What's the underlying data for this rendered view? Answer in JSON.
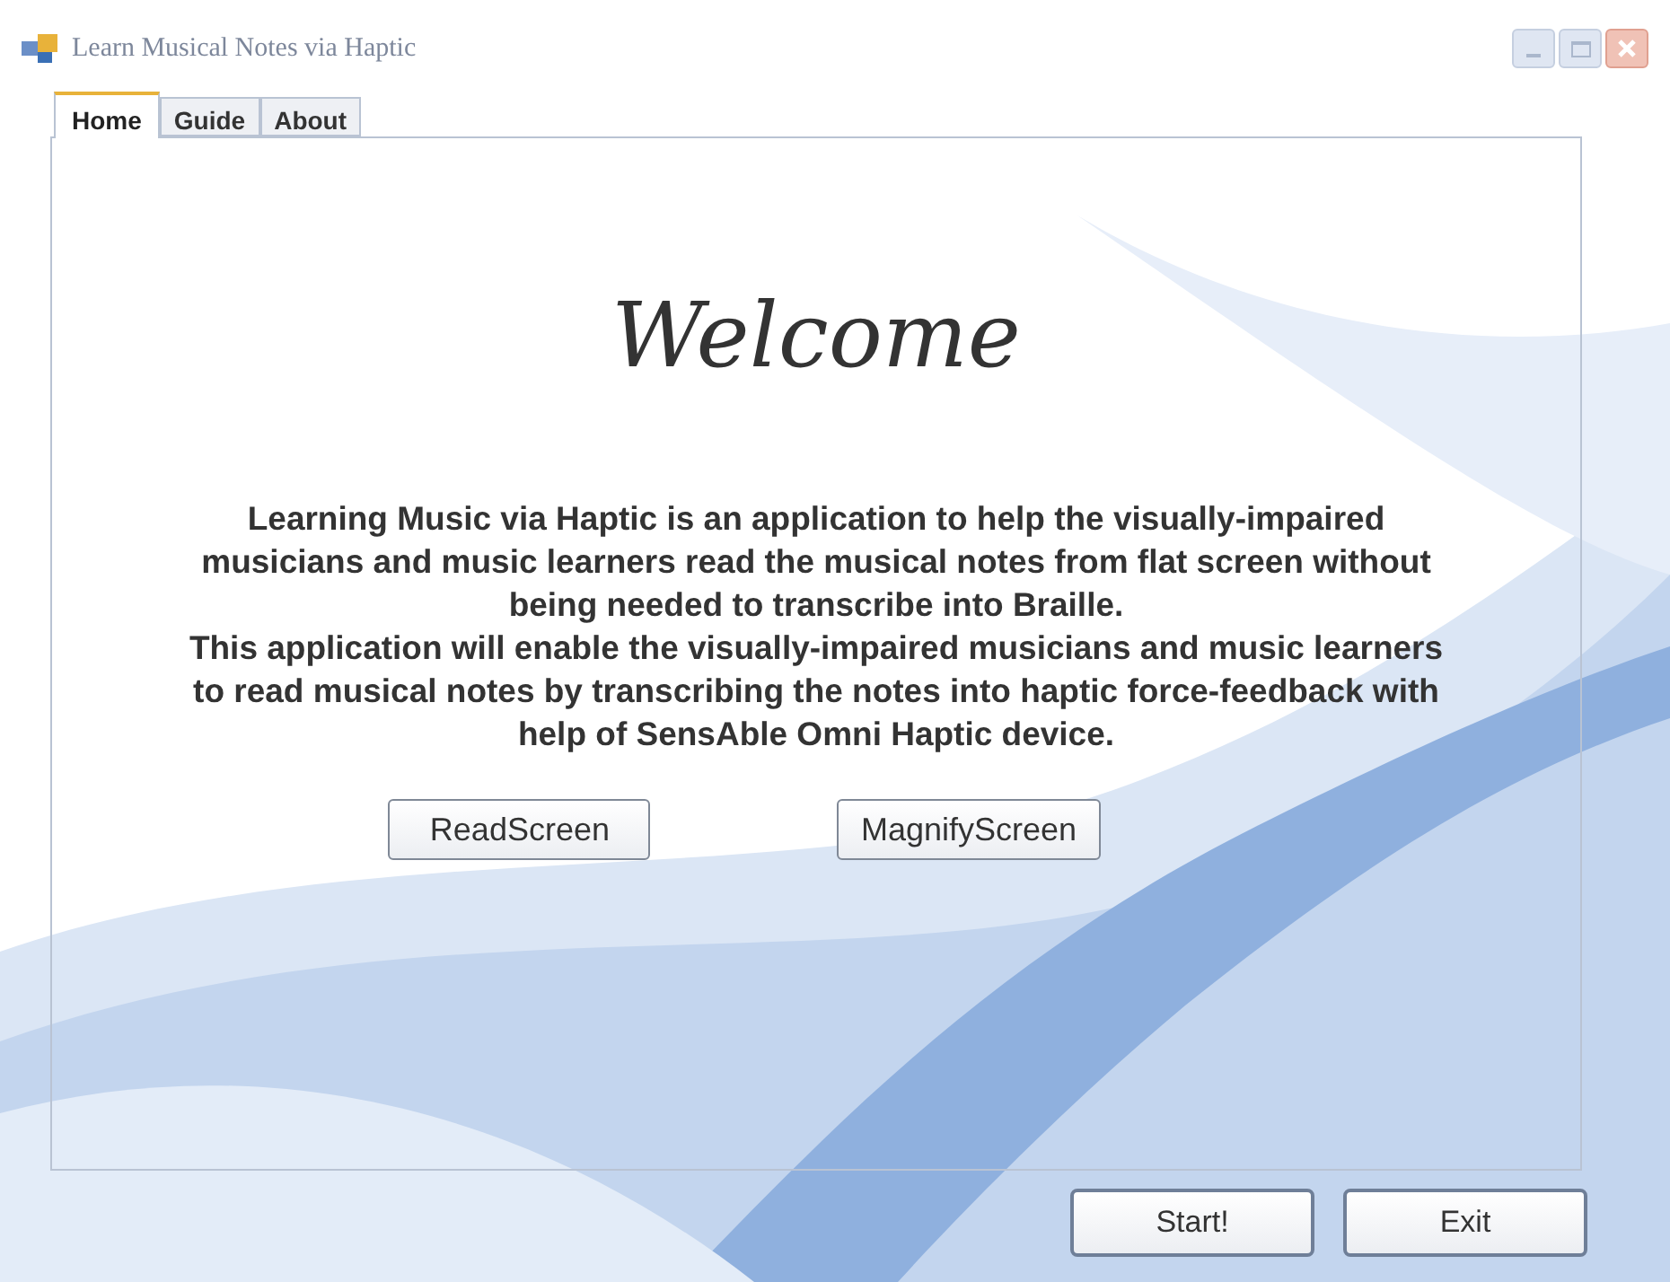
{
  "window": {
    "title": "Learn Musical Notes via Haptic"
  },
  "tabs": [
    {
      "label": "Home",
      "selected": true
    },
    {
      "label": "Guide",
      "selected": false
    },
    {
      "label": "About",
      "selected": false
    }
  ],
  "heading": "Welcome",
  "paragraphs": [
    "Learning Music via Haptic is an application to help the visually-impaired musicians and music learners read the musical notes from flat screen without being needed to transcribe into Braille.",
    "This application will enable the visually-impaired musicians and music learners to read musical notes by transcribing the notes into haptic force-feedback with help of SensAble Omni Haptic device."
  ],
  "panel_buttons": [
    "ReadScreen",
    "MagnifyScreen"
  ],
  "footer_buttons": [
    "Start!",
    "Exit"
  ]
}
